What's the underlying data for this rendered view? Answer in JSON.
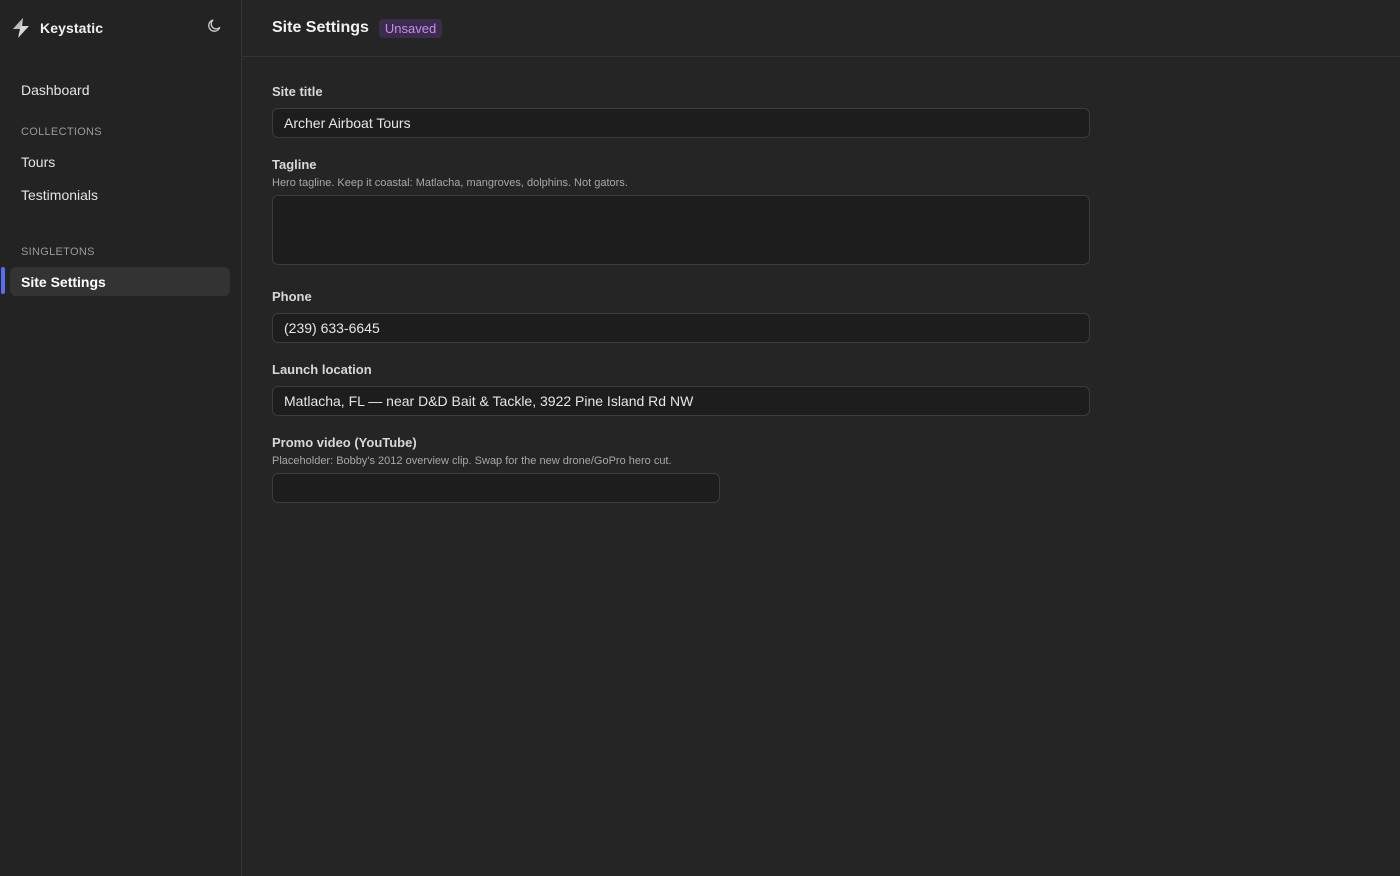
{
  "sidebar": {
    "brand": "Keystatic",
    "theme_icon": "moon-icon",
    "dashboard": "Dashboard",
    "collections_heading": "COLLECTIONS",
    "collections": [
      {
        "label": "Tours"
      },
      {
        "label": "Testimonials"
      }
    ],
    "singletons_heading": "SINGLETONS",
    "singletons": [
      {
        "label": "Site Settings",
        "active": true
      }
    ],
    "accent_color": "#5a6df0"
  },
  "header": {
    "title": "Site Settings",
    "status_badge": "Unsaved",
    "badge_color": "#c88cf0"
  },
  "form": {
    "site_title": {
      "label": "Site title",
      "value": "Archer Airboat Tours"
    },
    "tagline": {
      "label": "Tagline",
      "help": "Hero tagline. Keep it coastal: Matlacha, mangroves, dolphins. Not gators.",
      "value": ""
    },
    "phone": {
      "label": "Phone",
      "value": "(239) 633-6645"
    },
    "launch_location": {
      "label": "Launch location",
      "value": "Matlacha, FL — near D&D Bait & Tackle, 3922 Pine Island Rd NW"
    },
    "promo_video": {
      "label": "Promo video (YouTube)",
      "help": "Placeholder: Bobby's 2012 overview clip. Swap for the new drone/GoPro hero cut.",
      "value": ""
    }
  }
}
